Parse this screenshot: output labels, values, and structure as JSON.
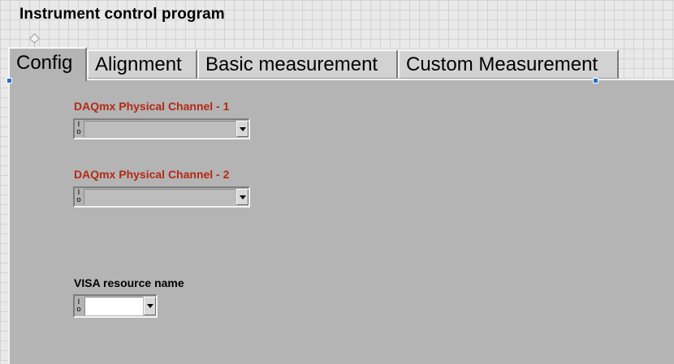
{
  "window": {
    "title": "Instrument control program"
  },
  "tabs": [
    {
      "label": "Config",
      "active": true
    },
    {
      "label": "Alignment",
      "active": false
    },
    {
      "label": "Basic measurement",
      "active": false
    },
    {
      "label": "Custom Measurement",
      "active": false
    }
  ],
  "config": {
    "daq_channel_1": {
      "label": "DAQmx Physical Channel - 1",
      "value": "",
      "icon": "io-name-icon"
    },
    "daq_channel_2": {
      "label": "DAQmx Physical Channel - 2",
      "value": "",
      "icon": "io-name-icon"
    },
    "visa_resource": {
      "label": "VISA resource name",
      "value": "",
      "icon": "io-name-icon"
    }
  },
  "colors": {
    "channel_label": "#b22a14",
    "panel_background": "#b4b4b4",
    "selection_handle": "#1f6fd1"
  }
}
